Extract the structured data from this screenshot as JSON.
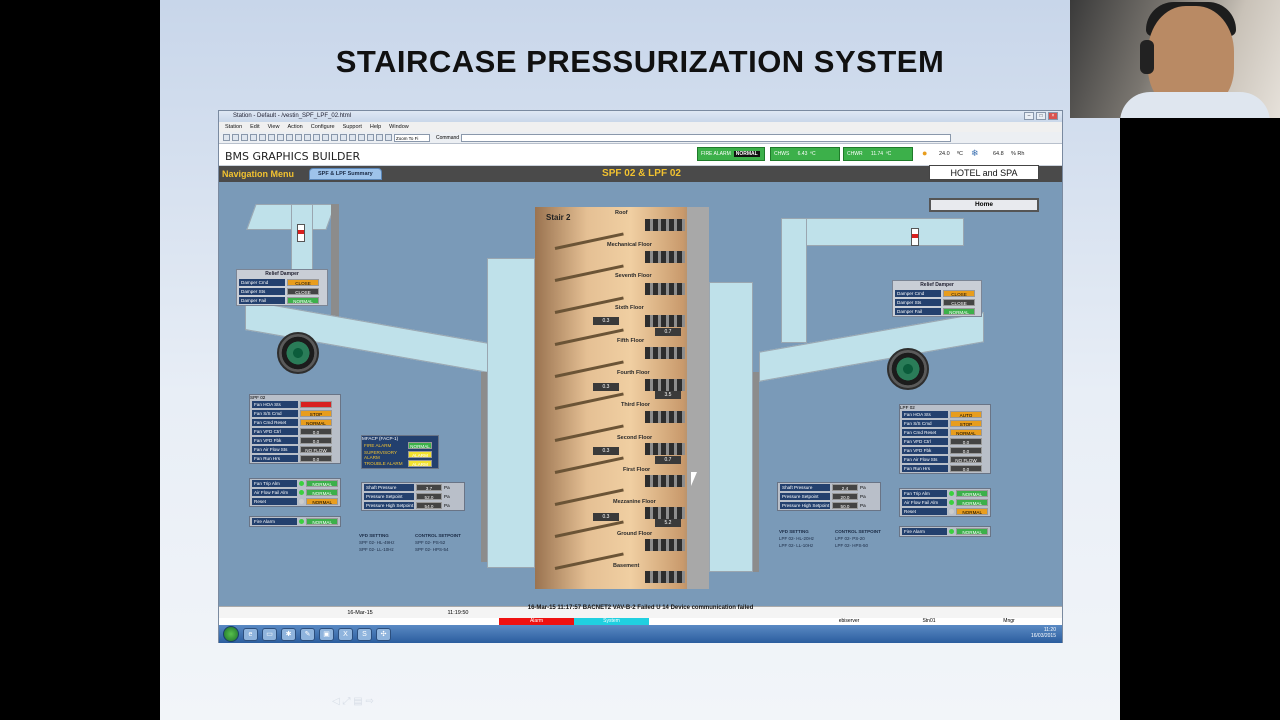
{
  "slide": {
    "title": "STAIRCASE PRESSURIZATION SYSTEM"
  },
  "window": {
    "title": "Station - Default - /vestin_SPF_LPF_02.html",
    "controls": [
      "–",
      "□",
      "×"
    ],
    "menu": [
      "Station",
      "Edit",
      "View",
      "Action",
      "Configure",
      "Support",
      "Help",
      "Window"
    ],
    "zoom": "Zoom To Fi",
    "command_label": "Command"
  },
  "header": {
    "app_title": "BMS GRAPHICS BUILDER",
    "fire_alarm_label": "FIRE ALARM",
    "fire_alarm_state": "NORMAL",
    "chws_label": "CHWS",
    "chws_value": "6.43",
    "chws_unit": "ºC",
    "chwr_label": "CHWR",
    "chwr_value": "11.74",
    "chwr_unit": "ºC",
    "temp": "24.0",
    "temp_unit": "ºC",
    "rh": "64.8",
    "rh_unit": "% Rh"
  },
  "nav": {
    "menu_label": "Navigation Menu",
    "tab": "SPF & LPF Summary",
    "center_title": "SPF 02 & LPF 02",
    "hotel": "HOTEL and SPA",
    "home": "Home"
  },
  "stair": {
    "name": "Stair 2",
    "floors": [
      "Roof",
      "Mechanical Floor",
      "Seventh Floor",
      "Sixth Floor",
      "Fifth Floor",
      "Fourth Floor",
      "Third Floor",
      "Second Floor",
      "First Floor",
      "Mezzanine Floor",
      "Ground Floor",
      "Basement"
    ],
    "pressures_left": [
      "0.3",
      "0.3",
      "0.3",
      "0.3"
    ],
    "pressures_right": [
      "0.7",
      "3.5",
      "0.7",
      "5.2"
    ]
  },
  "relief_left": {
    "title": "Relief Damper",
    "rows": [
      {
        "label": "Damper Cmd",
        "value": "CLOSE"
      },
      {
        "label": "Damper Sts",
        "value": "CLOSE"
      },
      {
        "label": "Damper Fail",
        "value": "NORMAL"
      }
    ]
  },
  "relief_right": {
    "title": "Relief Damper",
    "rows": [
      {
        "label": "Damper Cmd",
        "value": "CLOSE"
      },
      {
        "label": "Damper Sts",
        "value": "CLOSE"
      },
      {
        "label": "Damper Fail",
        "value": "NORMAL"
      }
    ]
  },
  "spf": {
    "title": "SPF 02",
    "rows": [
      {
        "label": "Fan HOA Sts",
        "value": ""
      },
      {
        "label": "Fan S/S Cmd",
        "value": "STOP"
      },
      {
        "label": "Fan Cmd Reset",
        "value": "NORMAL"
      },
      {
        "label": "Fan VFD Ctrl",
        "value": "0.0"
      },
      {
        "label": "Fan VFD Fbk",
        "value": "0.0"
      },
      {
        "label": "Fan Air Flow Sts",
        "value": "NO FLOW"
      },
      {
        "label": "Fan Run Hrs",
        "value": "0.0"
      }
    ],
    "alarms": [
      {
        "label": "Fan Trip Alm",
        "value": "NORMAL"
      },
      {
        "label": "Air Flow Fail Alm",
        "value": "NORMAL"
      },
      {
        "label": "Reset",
        "value": "NORMAL"
      }
    ],
    "fire_alarm": {
      "label": "Fire Alarm",
      "value": "NORMAL"
    },
    "pressure": [
      {
        "label": "Shaft Pressure",
        "value": "3.7",
        "unit": "Pa"
      },
      {
        "label": "Pressure Setpoint",
        "value": "52.0",
        "unit": "Pa"
      },
      {
        "label": "Pressure High Setpoint",
        "value": "54.0",
        "unit": "Pa"
      }
    ],
    "vfd_title": "VFD SETTING",
    "vfd_lines": [
      "SPF 02- HL-49Hz",
      "SPF 02- LL-10Hz"
    ],
    "ctrl_title": "CONTROL SETPOINT",
    "ctrl_lines": [
      "SPF 02- PS-52",
      "SPF 02- HPS-54"
    ]
  },
  "lpf": {
    "title": "LPF 02",
    "rows": [
      {
        "label": "Fan HOA Sts",
        "value": "AUTO"
      },
      {
        "label": "Fan S/S Cmd",
        "value": "STOP"
      },
      {
        "label": "Fan Cmd Reset",
        "value": "NORMAL"
      },
      {
        "label": "Fan VFD Ctrl",
        "value": "0.0"
      },
      {
        "label": "Fan VFD Fbk",
        "value": "0.0"
      },
      {
        "label": "Fan Air Flow Sts",
        "value": "NO FLOW"
      },
      {
        "label": "Fan Run Hrs",
        "value": "0.0"
      }
    ],
    "alarms": [
      {
        "label": "Fan Trip Alm",
        "value": "NORMAL"
      },
      {
        "label": "Air Flow Fail Alm",
        "value": "NORMAL"
      },
      {
        "label": "Reset",
        "value": "NORMAL"
      }
    ],
    "fire_alarm": {
      "label": "Fire Alarm",
      "value": "NORMAL"
    },
    "pressure": [
      {
        "label": "Shaft Pressure",
        "value": "2.4",
        "unit": "Pa"
      },
      {
        "label": "Pressure Setpoint",
        "value": "20.0",
        "unit": "Pa"
      },
      {
        "label": "Pressure High Setpoint",
        "value": "50.0",
        "unit": "Pa"
      }
    ],
    "vfd_title": "VFD SETTING",
    "vfd_lines": [
      "LPF 02- HL-20Hz",
      "LPF 02- LL-10Hz"
    ],
    "ctrl_title": "CONTROL SETPOINT",
    "ctrl_lines": [
      "LPF 02- PS-20",
      "LPF 02- HPS-50"
    ]
  },
  "facp": {
    "title": "MFACP (FACP-1)",
    "rows": [
      {
        "label": "FIRE ALARM",
        "value": "NORMAL"
      },
      {
        "label": "SUPERVISORY ALARM",
        "value": "ALARM"
      },
      {
        "label": "TROUBLE ALARM",
        "value": "ALARM"
      }
    ]
  },
  "statusbar": {
    "date": "16-Mar-15",
    "time": "11:19:50",
    "alarm_text": "16-Mar-15  11:17:57  BACNET2  VAV-B-2  Failed  U 14 Device communication failed",
    "cat_alarm": "Alarm",
    "cat_system": "System",
    "server": "ebiserver",
    "station": "Stn01",
    "user": "Mngr"
  },
  "taskbar": {
    "clock_time": "11:20",
    "clock_date": "16/03/2015"
  }
}
